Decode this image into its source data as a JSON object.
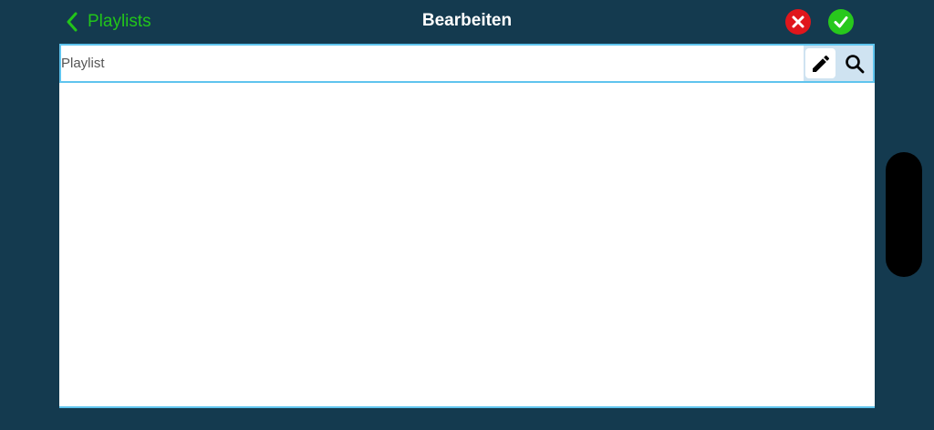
{
  "nav": {
    "back_label": "Playlists",
    "title": "Bearbeiten"
  },
  "search": {
    "placeholder": "Playlist",
    "value": ""
  },
  "icons": {
    "back": "chevron-left-icon",
    "cancel": "close-icon",
    "confirm": "checkmark-icon",
    "edit": "pencil-icon",
    "search": "search-icon"
  },
  "colors": {
    "background": "#143a4f",
    "accent_green": "#22c51a",
    "cancel_red": "#e0161c",
    "confirm_green": "#28c81c",
    "border_blue": "#5fc4ee"
  },
  "list": {
    "items": []
  }
}
